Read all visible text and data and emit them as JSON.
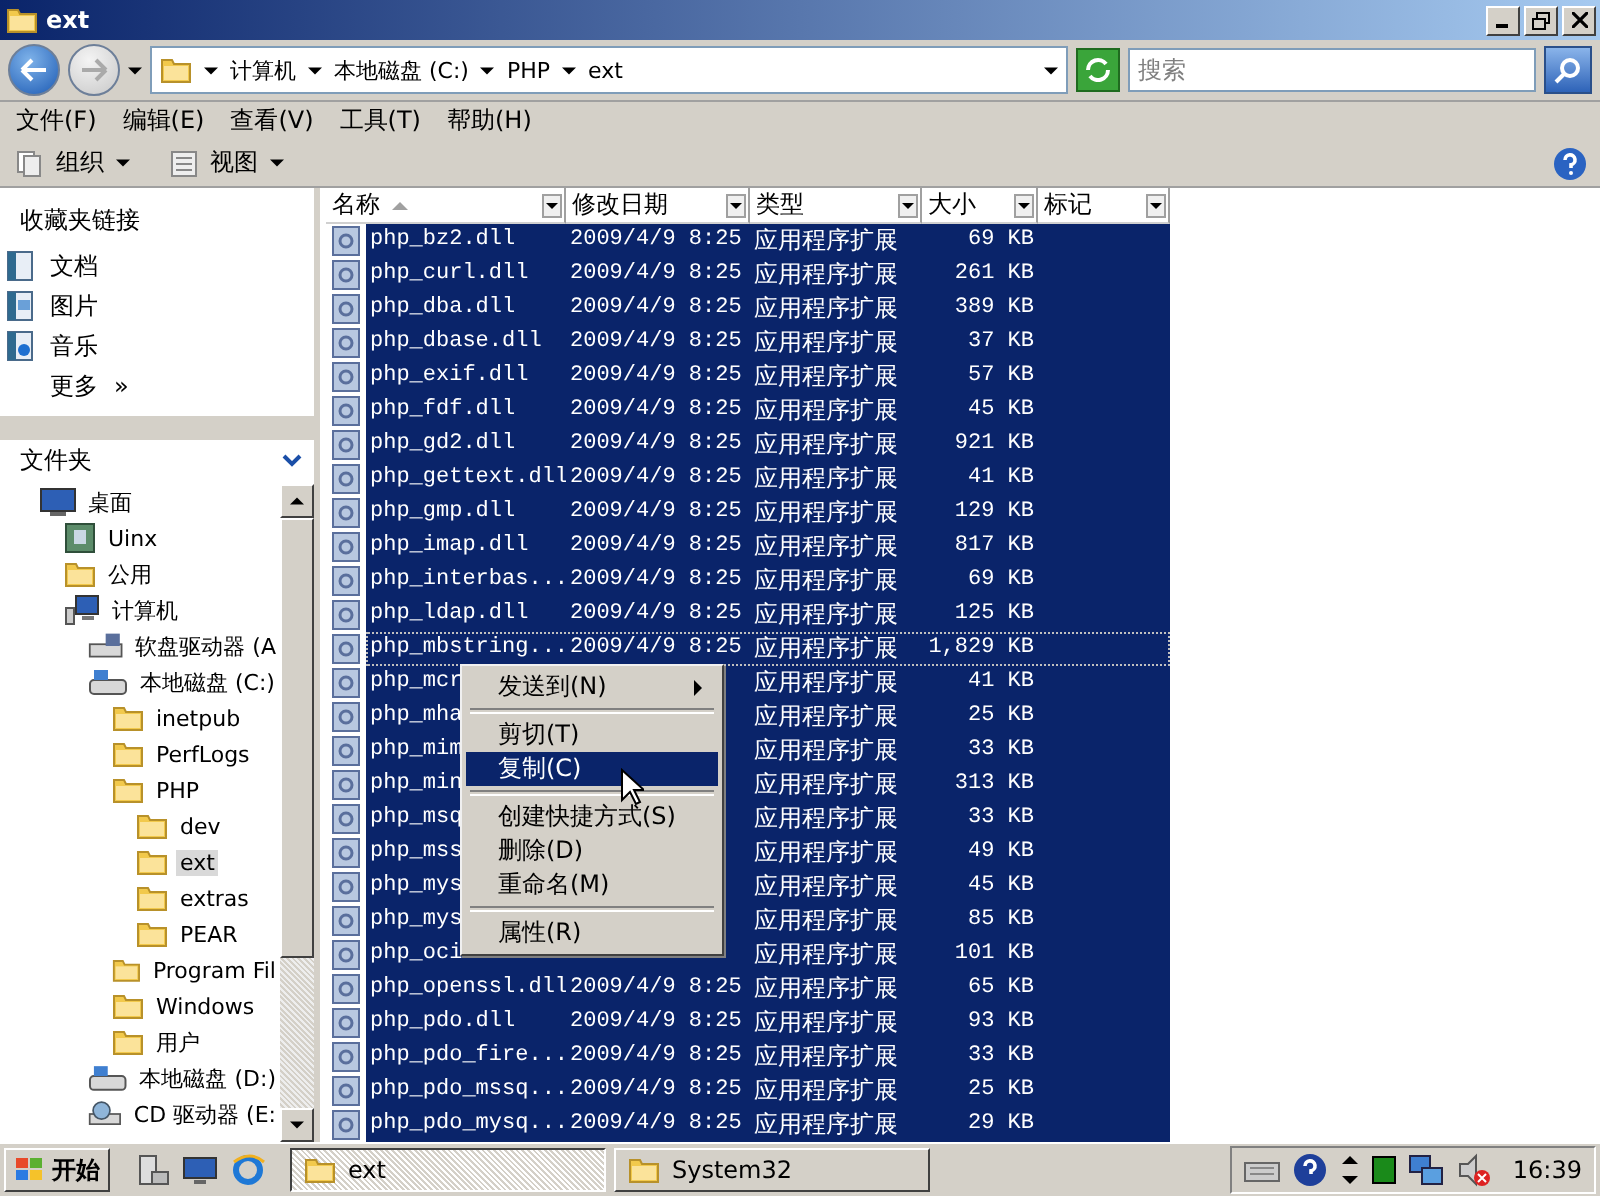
{
  "window": {
    "title": "ext"
  },
  "address": {
    "crumbs": [
      "计算机",
      "本地磁盘 (C:)",
      "PHP",
      "ext"
    ]
  },
  "search": {
    "placeholder": "搜索"
  },
  "menu": [
    "文件(F)",
    "编辑(E)",
    "查看(V)",
    "工具(T)",
    "帮助(H)"
  ],
  "toolbar": [
    "组织",
    "视图"
  ],
  "favorites": {
    "title": "收藏夹链接",
    "items": [
      {
        "label": "文档",
        "kind": "doc"
      },
      {
        "label": "图片",
        "kind": "picture"
      },
      {
        "label": "音乐",
        "kind": "music"
      }
    ],
    "more": "更多",
    "more_arrow": "»"
  },
  "folders": {
    "title": "文件夹",
    "tree": [
      {
        "label": "桌面",
        "kind": "desktop",
        "selected": false,
        "children": [
          {
            "label": "Uinx",
            "kind": "user",
            "selected": false
          },
          {
            "label": "公用",
            "kind": "folder",
            "selected": false
          },
          {
            "label": "计算机",
            "kind": "computer",
            "selected": false,
            "children": [
              {
                "label": "软盘驱动器 (A",
                "kind": "floppy",
                "selected": false
              },
              {
                "label": "本地磁盘 (C:)",
                "kind": "drive",
                "selected": false,
                "children": [
                  {
                    "label": "inetpub",
                    "kind": "folder",
                    "selected": false
                  },
                  {
                    "label": "PerfLogs",
                    "kind": "folder",
                    "selected": false
                  },
                  {
                    "label": "PHP",
                    "kind": "folder",
                    "selected": false,
                    "children": [
                      {
                        "label": "dev",
                        "kind": "folder",
                        "selected": false
                      },
                      {
                        "label": "ext",
                        "kind": "folder",
                        "selected": true
                      },
                      {
                        "label": "extras",
                        "kind": "folder",
                        "selected": false
                      },
                      {
                        "label": "PEAR",
                        "kind": "folder",
                        "selected": false
                      }
                    ]
                  },
                  {
                    "label": "Program Fil",
                    "kind": "folder",
                    "selected": false
                  },
                  {
                    "label": "Windows",
                    "kind": "folder",
                    "selected": false
                  },
                  {
                    "label": "用户",
                    "kind": "folder",
                    "selected": false
                  }
                ]
              },
              {
                "label": "本地磁盘 (D:)",
                "kind": "drive",
                "selected": false
              },
              {
                "label": "CD 驱动器 (E:",
                "kind": "cd",
                "selected": false
              }
            ]
          }
        ]
      }
    ]
  },
  "columns": [
    {
      "label": "名称",
      "sorted": true
    },
    {
      "label": "修改日期",
      "sorted": false
    },
    {
      "label": "类型",
      "sorted": false
    },
    {
      "label": "大小",
      "sorted": false
    },
    {
      "label": "标记",
      "sorted": false
    }
  ],
  "files": [
    {
      "name": "php_bz2.dll",
      "date": "2009/4/9 8:25",
      "type": "应用程序扩展",
      "size": "69 KB",
      "selected": true,
      "focused": false
    },
    {
      "name": "php_curl.dll",
      "date": "2009/4/9 8:25",
      "type": "应用程序扩展",
      "size": "261 KB",
      "selected": true,
      "focused": false
    },
    {
      "name": "php_dba.dll",
      "date": "2009/4/9 8:25",
      "type": "应用程序扩展",
      "size": "389 KB",
      "selected": true,
      "focused": false
    },
    {
      "name": "php_dbase.dll",
      "date": "2009/4/9 8:25",
      "type": "应用程序扩展",
      "size": "37 KB",
      "selected": true,
      "focused": false
    },
    {
      "name": "php_exif.dll",
      "date": "2009/4/9 8:25",
      "type": "应用程序扩展",
      "size": "57 KB",
      "selected": true,
      "focused": false
    },
    {
      "name": "php_fdf.dll",
      "date": "2009/4/9 8:25",
      "type": "应用程序扩展",
      "size": "45 KB",
      "selected": true,
      "focused": false
    },
    {
      "name": "php_gd2.dll",
      "date": "2009/4/9 8:25",
      "type": "应用程序扩展",
      "size": "921 KB",
      "selected": true,
      "focused": false
    },
    {
      "name": "php_gettext.dll",
      "date": "2009/4/9 8:25",
      "type": "应用程序扩展",
      "size": "41 KB",
      "selected": true,
      "focused": false
    },
    {
      "name": "php_gmp.dll",
      "date": "2009/4/9 8:25",
      "type": "应用程序扩展",
      "size": "129 KB",
      "selected": true,
      "focused": false
    },
    {
      "name": "php_imap.dll",
      "date": "2009/4/9 8:25",
      "type": "应用程序扩展",
      "size": "817 KB",
      "selected": true,
      "focused": false
    },
    {
      "name": "php_interbas...",
      "date": "2009/4/9 8:25",
      "type": "应用程序扩展",
      "size": "69 KB",
      "selected": true,
      "focused": false
    },
    {
      "name": "php_ldap.dll",
      "date": "2009/4/9 8:25",
      "type": "应用程序扩展",
      "size": "125 KB",
      "selected": true,
      "focused": false
    },
    {
      "name": "php_mbstring...",
      "date": "2009/4/9 8:25",
      "type": "应用程序扩展",
      "size": "1,829 KB",
      "selected": true,
      "focused": true
    },
    {
      "name": "php_mcr",
      "type": "应用程序扩展",
      "size": "41 KB",
      "selected": true,
      "focused": false
    },
    {
      "name": "php_mha",
      "type": "应用程序扩展",
      "size": "25 KB",
      "selected": true,
      "focused": false
    },
    {
      "name": "php_mim",
      "type": "应用程序扩展",
      "size": "33 KB",
      "selected": true,
      "focused": false
    },
    {
      "name": "php_min",
      "type": "应用程序扩展",
      "size": "313 KB",
      "selected": true,
      "focused": false
    },
    {
      "name": "php_msq",
      "type": "应用程序扩展",
      "size": "33 KB",
      "selected": true,
      "focused": false
    },
    {
      "name": "php_mss",
      "type": "应用程序扩展",
      "size": "49 KB",
      "selected": true,
      "focused": false
    },
    {
      "name": "php_mys",
      "type": "应用程序扩展",
      "size": "45 KB",
      "selected": true,
      "focused": false
    },
    {
      "name": "php_mys",
      "type": "应用程序扩展",
      "size": "85 KB",
      "selected": true,
      "focused": false
    },
    {
      "name": "php_oci",
      "type": "应用程序扩展",
      "size": "101 KB",
      "selected": true,
      "focused": false
    },
    {
      "name": "php_openssl.dll",
      "date": "2009/4/9 8:25",
      "type": "应用程序扩展",
      "size": "65 KB",
      "selected": true,
      "focused": false
    },
    {
      "name": "php_pdo.dll",
      "date": "2009/4/9 8:25",
      "type": "应用程序扩展",
      "size": "93 KB",
      "selected": true,
      "focused": false
    },
    {
      "name": "php_pdo_fire...",
      "date": "2009/4/9 8:25",
      "type": "应用程序扩展",
      "size": "33 KB",
      "selected": true,
      "focused": false
    },
    {
      "name": "php_pdo_mssq...",
      "date": "2009/4/9 8:25",
      "type": "应用程序扩展",
      "size": "25 KB",
      "selected": true,
      "focused": false
    },
    {
      "name": "php_pdo_mysq...",
      "date": "2009/4/9 8:25",
      "type": "应用程序扩展",
      "size": "29 KB",
      "selected": true,
      "focused": false
    }
  ],
  "context_menu": [
    {
      "kind": "item",
      "label": "发送到(N)",
      "submenu": true,
      "selected": false
    },
    {
      "kind": "separator"
    },
    {
      "kind": "item",
      "label": "剪切(T)",
      "submenu": false,
      "selected": false
    },
    {
      "kind": "item",
      "label": "复制(C)",
      "submenu": false,
      "selected": true
    },
    {
      "kind": "separator"
    },
    {
      "kind": "item",
      "label": "创建快捷方式(S)",
      "submenu": false,
      "selected": false
    },
    {
      "kind": "item",
      "label": "删除(D)",
      "submenu": false,
      "selected": false
    },
    {
      "kind": "item",
      "label": "重命名(M)",
      "submenu": false,
      "selected": false
    },
    {
      "kind": "separator"
    },
    {
      "kind": "item",
      "label": "属性(R)",
      "submenu": false,
      "selected": false
    }
  ],
  "taskbar": {
    "start": "开始",
    "tasks": [
      {
        "label": "ext",
        "selected": true
      },
      {
        "label": "System32",
        "selected": false
      }
    ],
    "clock": "16:39"
  }
}
